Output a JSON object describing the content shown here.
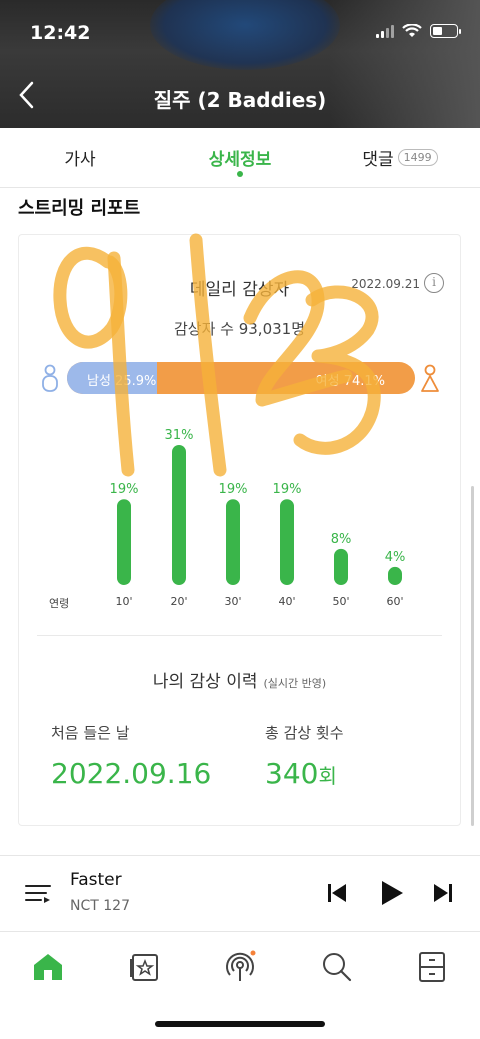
{
  "status": {
    "time": "12:42"
  },
  "header": {
    "title": "질주 (2 Baddies)",
    "back_icon": "chevron-left-icon"
  },
  "tabs": [
    {
      "label": "가사"
    },
    {
      "label": "상세정보",
      "active": true
    },
    {
      "label": "댓글",
      "badge": "1499"
    }
  ],
  "section_title": "스트리밍 리포트",
  "daily": {
    "title": "데일리 감상자",
    "date": "2022.09.21",
    "info_symbol": "i",
    "listeners": "감상자 수 93,031명",
    "male_label": "남성 25.9%",
    "female_label": "여성 74.1%",
    "male_fraction": 0.259,
    "male_color": "#9db9ea",
    "female_color": "#f29d48"
  },
  "chart_data": {
    "type": "bar",
    "axis_title": "연령",
    "categories": [
      "10'",
      "20'",
      "30'",
      "40'",
      "50'",
      "60'"
    ],
    "values": [
      19,
      31,
      19,
      19,
      8,
      4
    ],
    "labels": [
      "19%",
      "31%",
      "19%",
      "19%",
      "8%",
      "4%"
    ],
    "color": "#3ab54a"
  },
  "history": {
    "title": "나의 감상 이력",
    "subtitle": "(실시간 반영)",
    "first_label": "처음 들은 날",
    "first_value": "2022.09.16",
    "count_label": "총 감상 횟수",
    "count_value": "340",
    "count_unit": "회"
  },
  "player": {
    "title": "Faster",
    "artist": "NCT 127"
  },
  "accent": "#3ab54a",
  "nav": [
    "home-icon",
    "music-card-icon",
    "podcast-icon",
    "search-icon",
    "drawer-icon"
  ]
}
